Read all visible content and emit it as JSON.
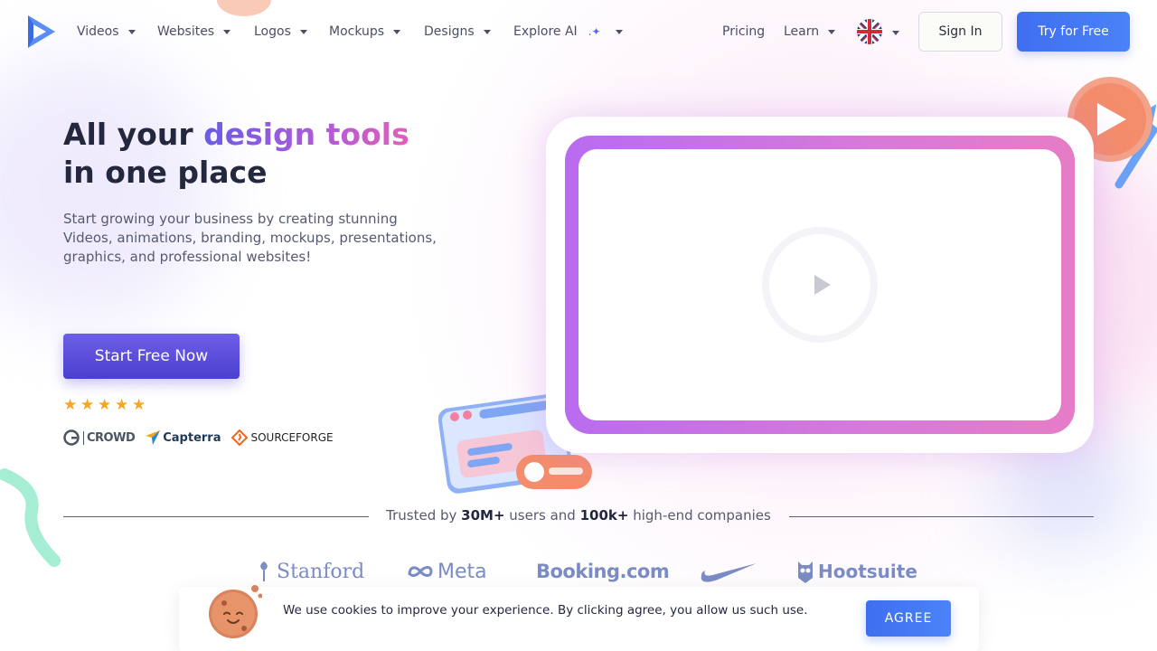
{
  "nav": {
    "items": [
      {
        "label": "Videos"
      },
      {
        "label": "Websites"
      },
      {
        "label": "Logos"
      },
      {
        "label": "Mockups"
      },
      {
        "label": "Designs"
      },
      {
        "label": "Explore AI"
      }
    ],
    "pricing": "Pricing",
    "learn": "Learn",
    "sign_in": "Sign In",
    "try_free": "Try for Free",
    "language_icon": "uk-flag-icon"
  },
  "hero": {
    "title_pre": "All your ",
    "title_highlight": "design tools",
    "title_post": " in one place",
    "subtitle": "Start growing your business by creating stunning Videos, animations, branding, mockups, presentations, graphics, and professional websites!",
    "cta": "Start Free Now",
    "rating_stars": 5,
    "badges": [
      "CROWD",
      "Capterra",
      "SOURCEFORGE"
    ]
  },
  "trusted": {
    "pre": "Trusted by ",
    "users": "30M+",
    "mid": " users and ",
    "companies": "100k+",
    "post": " high-end companies",
    "logos": [
      "Stanford",
      "Meta",
      "Booking.com",
      "Nike",
      "Hootsuite"
    ]
  },
  "cookie": {
    "text": "We use cookies to improve your experience. By clicking agree, you allow us such use.",
    "agree": "AGREE"
  },
  "colors": {
    "accent_blue": "#4a82f7",
    "accent_purple": "#5b4ad8",
    "frame_gradient_start": "#b96cf0",
    "frame_gradient_end": "#e67cc7"
  }
}
